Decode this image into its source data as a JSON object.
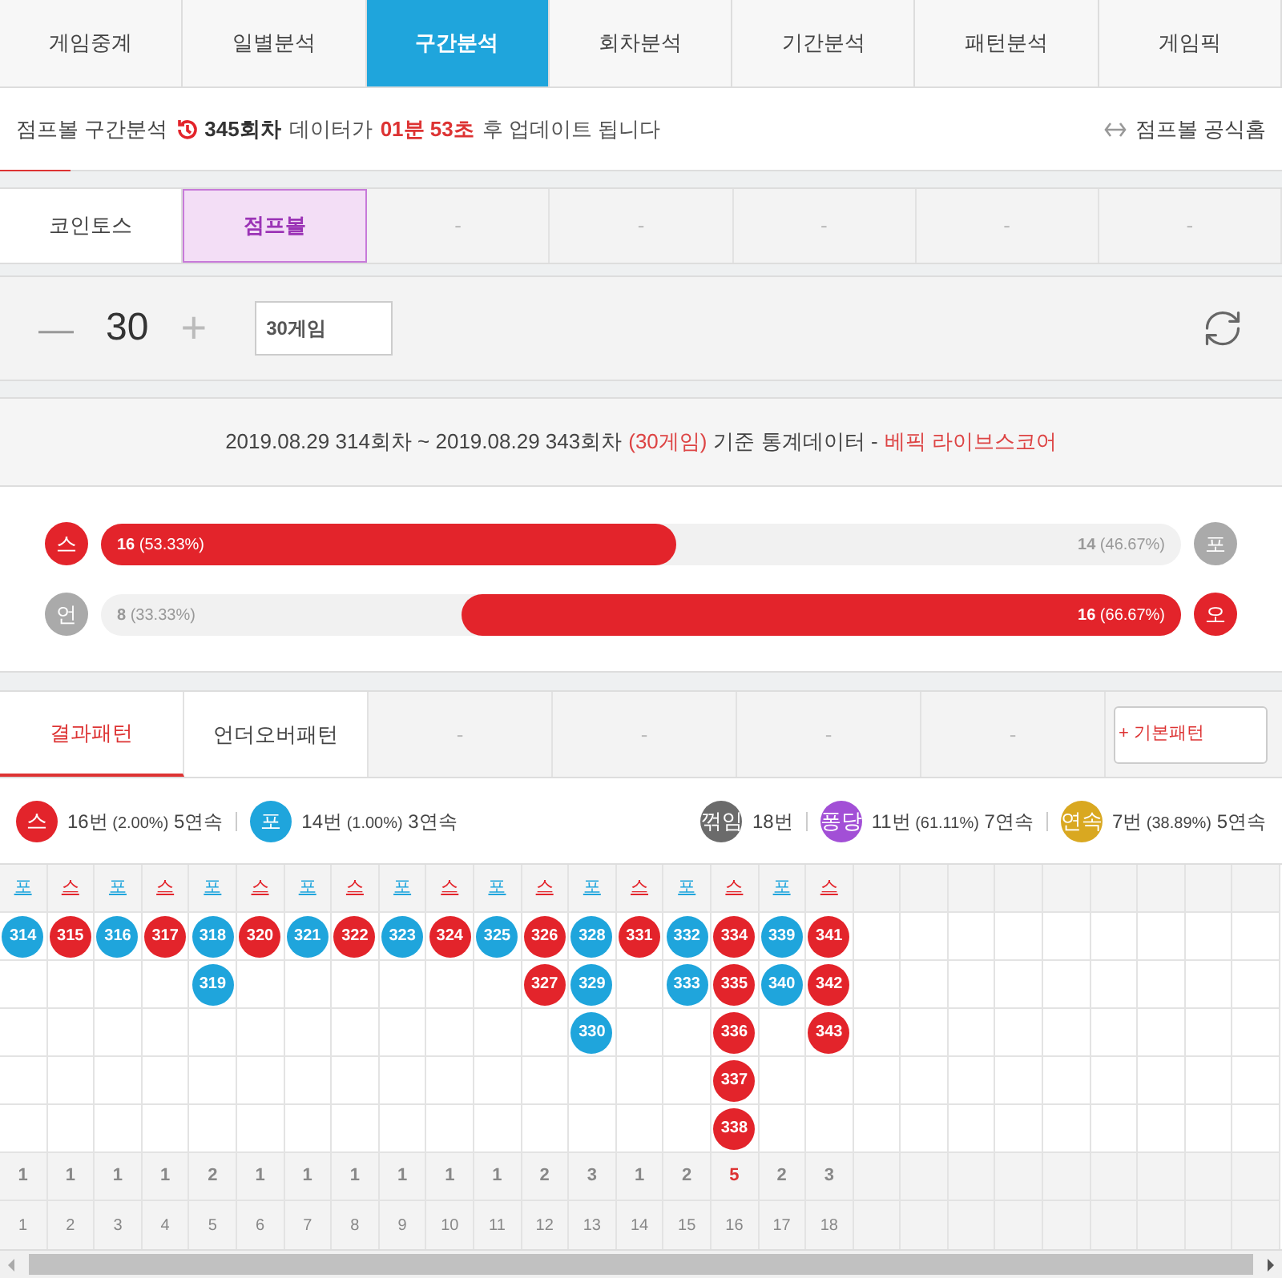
{
  "main_tabs": [
    {
      "label": "게임중계",
      "selected": false
    },
    {
      "label": "일별분석",
      "selected": false
    },
    {
      "label": "구간분석",
      "selected": true
    },
    {
      "label": "회차분석",
      "selected": false
    },
    {
      "label": "기간분석",
      "selected": false
    },
    {
      "label": "패턴분석",
      "selected": false
    },
    {
      "label": "게임픽",
      "selected": false
    }
  ],
  "info_bar": {
    "title": "점프볼 구간분석",
    "round": "345회차",
    "text_before": "데이터가",
    "countdown": "01분 53초",
    "text_after": "후 업데이트 됩니다",
    "home_link": "점프볼 공식홈"
  },
  "game_tabs": [
    {
      "label": "코인토스",
      "selected": false
    },
    {
      "label": "점프볼",
      "selected": true
    },
    {
      "label": "-",
      "selected": false
    },
    {
      "label": "-",
      "selected": false
    },
    {
      "label": "-",
      "selected": false
    },
    {
      "label": "-",
      "selected": false
    },
    {
      "label": "-",
      "selected": false
    }
  ],
  "counter": {
    "minus": "—",
    "value": "30",
    "plus": "+",
    "field_value": "30게임"
  },
  "stats": {
    "range": "2019.08.29 314회차 ~ 2019.08.29 343회차",
    "games": "(30게임)",
    "basis": "기준 통계데이터 -",
    "source": "베픽 라이브스코어",
    "bars": [
      {
        "left_badge": "스",
        "left_value": "16",
        "left_pct": "(53.33%)",
        "right_value": "14",
        "right_pct": "(46.67%)",
        "right_badge": "포",
        "kind": "left",
        "level": 0.5333
      },
      {
        "left_badge": "언",
        "left_value": "8",
        "left_pct": "(33.33%)",
        "right_value": "16",
        "right_pct": "(66.67%)",
        "right_badge": "오",
        "kind": "right",
        "level": 0.6667
      }
    ]
  },
  "pattern_tabs": [
    {
      "label": "결과패턴",
      "selected": true
    },
    {
      "label": "언더오버패턴",
      "selected": false
    },
    {
      "label": "-",
      "selected": false
    },
    {
      "label": "-",
      "selected": false
    },
    {
      "label": "-",
      "selected": false
    },
    {
      "label": "-",
      "selected": false
    }
  ],
  "pattern_button": "+ 기본패턴",
  "legend_left": [
    {
      "badge": "스",
      "color": "#e3242b",
      "count": "16번",
      "pct": "(2.00%)",
      "streak": "5연속"
    },
    {
      "badge": "포",
      "color": "#1fa5dc",
      "count": "14번",
      "pct": "(1.00%)",
      "streak": "3연속"
    }
  ],
  "legend_right": [
    {
      "badge": "꺾임",
      "color": "#6b6b6b",
      "count": "18번"
    },
    {
      "badge": "퐁당",
      "color": "#a24fd6",
      "count": "11번",
      "pct": "(61.11%)",
      "streak": "7연속"
    },
    {
      "badge": "연속",
      "color": "#d9a821",
      "count": "7번",
      "pct": "(38.89%)",
      "streak": "5연속"
    }
  ],
  "grid": [
    {
      "kind": "po",
      "label": "포",
      "balls": [
        "314"
      ],
      "count": "1",
      "max": false,
      "index": "1"
    },
    {
      "kind": "seu",
      "label": "스",
      "balls": [
        "315"
      ],
      "count": "1",
      "max": false,
      "index": "2"
    },
    {
      "kind": "po",
      "label": "포",
      "balls": [
        "316"
      ],
      "count": "1",
      "max": false,
      "index": "3"
    },
    {
      "kind": "seu",
      "label": "스",
      "balls": [
        "317"
      ],
      "count": "1",
      "max": false,
      "index": "4"
    },
    {
      "kind": "po",
      "label": "포",
      "balls": [
        "318",
        "319"
      ],
      "count": "2",
      "max": false,
      "index": "5"
    },
    {
      "kind": "seu",
      "label": "스",
      "balls": [
        "320"
      ],
      "count": "1",
      "max": false,
      "index": "6"
    },
    {
      "kind": "po",
      "label": "포",
      "balls": [
        "321"
      ],
      "count": "1",
      "max": false,
      "index": "7"
    },
    {
      "kind": "seu",
      "label": "스",
      "balls": [
        "322"
      ],
      "count": "1",
      "max": false,
      "index": "8"
    },
    {
      "kind": "po",
      "label": "포",
      "balls": [
        "323"
      ],
      "count": "1",
      "max": false,
      "index": "9"
    },
    {
      "kind": "seu",
      "label": "스",
      "balls": [
        "324"
      ],
      "count": "1",
      "max": false,
      "index": "10"
    },
    {
      "kind": "po",
      "label": "포",
      "balls": [
        "325"
      ],
      "count": "1",
      "max": false,
      "index": "11"
    },
    {
      "kind": "seu",
      "label": "스",
      "balls": [
        "326",
        "327"
      ],
      "count": "2",
      "max": false,
      "index": "12"
    },
    {
      "kind": "po",
      "label": "포",
      "balls": [
        "328",
        "329",
        "330"
      ],
      "count": "3",
      "max": false,
      "index": "13"
    },
    {
      "kind": "seu",
      "label": "스",
      "balls": [
        "331"
      ],
      "count": "1",
      "max": false,
      "index": "14"
    },
    {
      "kind": "po",
      "label": "포",
      "balls": [
        "332",
        "333"
      ],
      "count": "2",
      "max": false,
      "index": "15"
    },
    {
      "kind": "seu",
      "label": "스",
      "balls": [
        "334",
        "335",
        "336",
        "337",
        "338"
      ],
      "count": "5",
      "max": true,
      "index": "16"
    },
    {
      "kind": "po",
      "label": "포",
      "balls": [
        "339",
        "340"
      ],
      "count": "2",
      "max": false,
      "index": "17"
    },
    {
      "kind": "seu",
      "label": "스",
      "balls": [
        "341",
        "342",
        "343"
      ],
      "count": "3",
      "max": false,
      "index": "18"
    }
  ]
}
